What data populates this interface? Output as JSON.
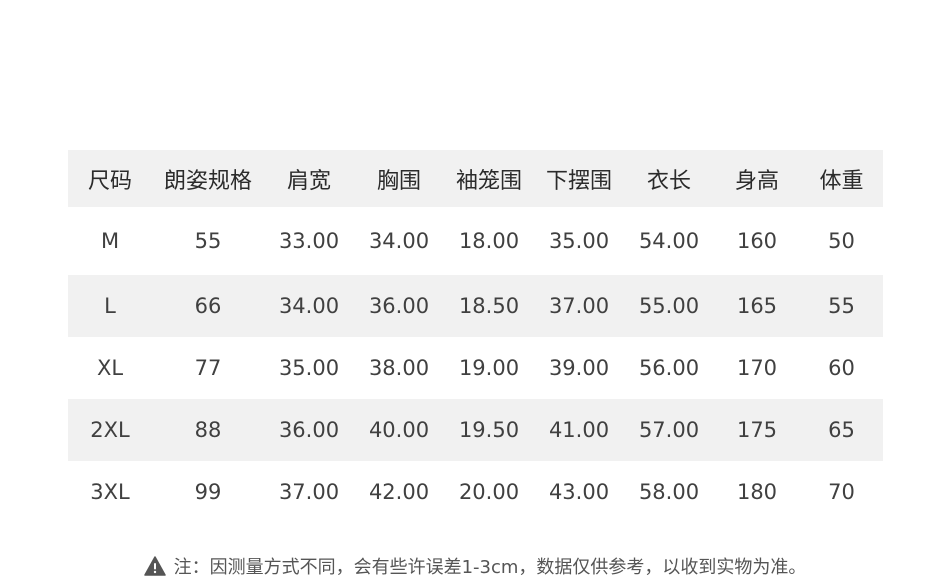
{
  "table": {
    "headers": [
      "尺码",
      "朗姿规格",
      "肩宽",
      "胸围",
      "袖笼围",
      "下摆围",
      "衣长",
      "身高",
      "体重"
    ],
    "rows": [
      [
        "M",
        "55",
        "33.00",
        "34.00",
        "18.00",
        "35.00",
        "54.00",
        "160",
        "50"
      ],
      [
        "L",
        "66",
        "34.00",
        "36.00",
        "18.50",
        "37.00",
        "55.00",
        "165",
        "55"
      ],
      [
        "XL",
        "77",
        "35.00",
        "38.00",
        "19.00",
        "39.00",
        "56.00",
        "170",
        "60"
      ],
      [
        "2XL",
        "88",
        "36.00",
        "40.00",
        "19.50",
        "41.00",
        "57.00",
        "175",
        "65"
      ],
      [
        "3XL",
        "99",
        "37.00",
        "42.00",
        "20.00",
        "43.00",
        "58.00",
        "180",
        "70"
      ]
    ]
  },
  "note": {
    "icon": "warning-icon",
    "text": "注：因测量方式不同，会有些许误差1-3cm，数据仅供参考，以收到实物为准。"
  },
  "colors": {
    "stripe": "#f1f1f1",
    "header_text": "#2b2b2b",
    "cell_text": "#404040",
    "icon": "#555555"
  }
}
